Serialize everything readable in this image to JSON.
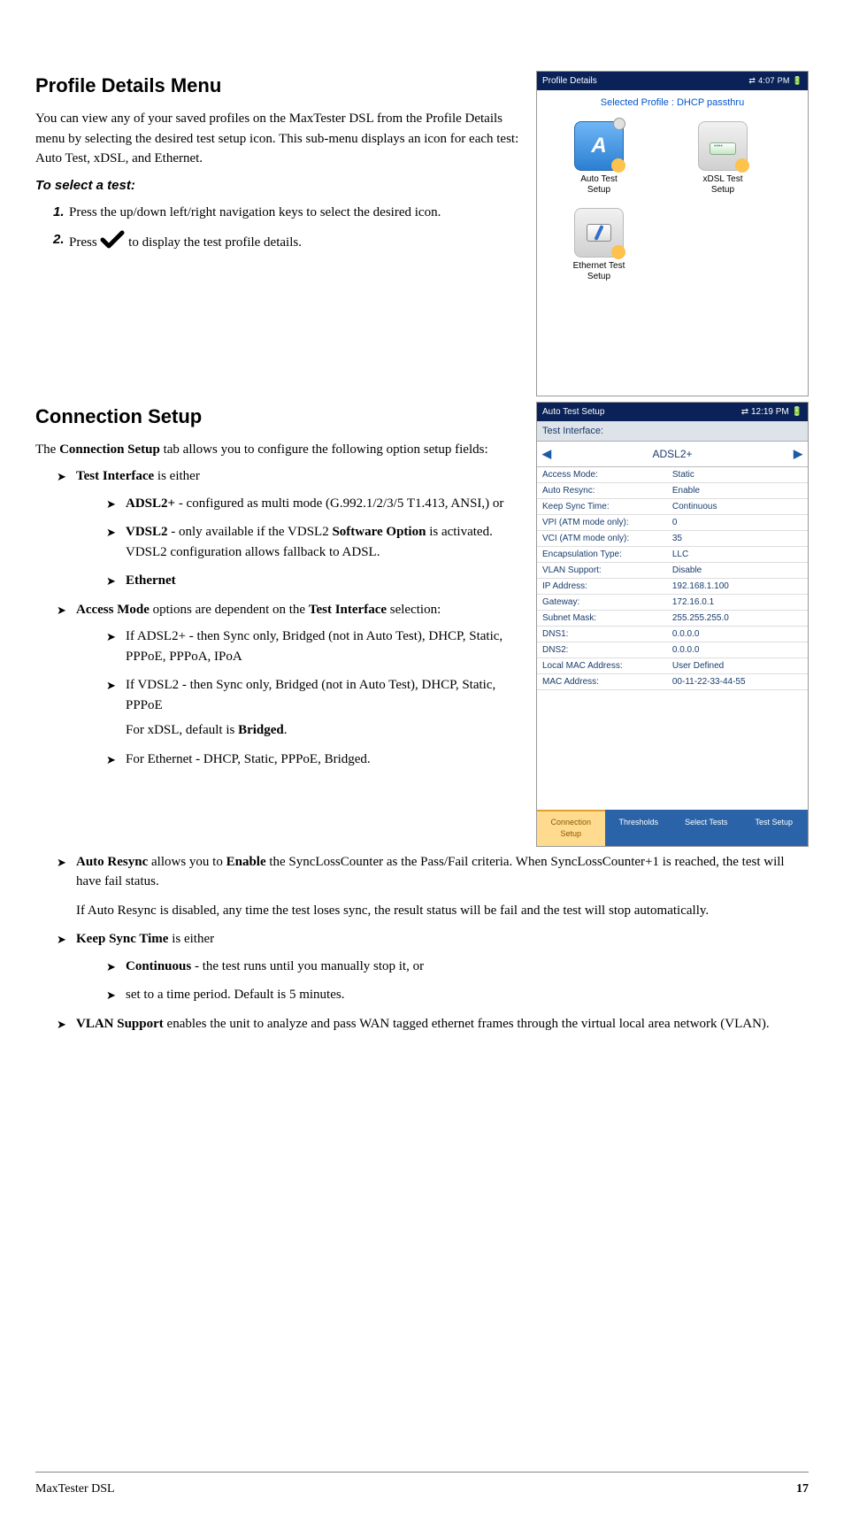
{
  "section1": {
    "heading": "Profile Details Menu",
    "intro": "You can view any of your saved profiles on the MaxTester DSL from the Profile Details menu by selecting the desired test setup icon. This sub-menu displays an icon for each test: Auto Test, xDSL, and Ethernet.",
    "subheading": "To select a test:",
    "steps": [
      {
        "num": "1.",
        "text": "Press the up/down left/right navigation keys to select the desired icon."
      },
      {
        "num": "2.",
        "pre": "Press ",
        "post": " to display the test profile details."
      }
    ]
  },
  "section2": {
    "heading": "Connection Setup",
    "intro_pre": "The ",
    "intro_bold": "Connection Setup",
    "intro_post": " tab allows you to configure the following option setup fields:",
    "test_interface": {
      "label_bold": "Test Interface",
      "label_rest": " is either",
      "items": {
        "adsl_bold": "ADSL2+",
        "adsl_rest": " - configured as multi mode (G.992.1/2/3/5 T1.413, ANSI,) or",
        "vdsl_bold": "VDSL2",
        "vdsl_mid": " - only available if the VDSL2 ",
        "vdsl_bold2": "Software Option",
        "vdsl_rest": " is activated. VDSL2 configuration allows fallback to ADSL.",
        "eth_bold": "Ethernet"
      }
    },
    "access_mode": {
      "bold1": "Access Mode",
      "mid": " options are dependent on the ",
      "bold2": "Test Interface",
      "rest": " selection:",
      "items": {
        "adsl": "If ADSL2+ - then Sync only, Bridged (not in Auto Test), DHCP, Static, PPPoE, PPPoA, IPoA",
        "vdsl": "If VDSL2 - then Sync only, Bridged (not in Auto Test), DHCP, Static, PPPoE",
        "default_pre": "For xDSL, default is ",
        "default_bold": "Bridged",
        "default_post": ".",
        "eth": "For Ethernet - DHCP, Static, PPPoE, Bridged."
      }
    },
    "auto_resync": {
      "bold1": "Auto Resync",
      "mid": " allows you to ",
      "bold2": "Enable",
      "rest": " the SyncLossCounter as the Pass/Fail criteria. When SyncLossCounter+1 is reached, the test will have fail status.",
      "para2": "If Auto Resync is disabled, any time the test loses sync, the result status will be fail and the test will stop automatically."
    },
    "keep_sync": {
      "bold": "Keep Sync Time",
      "rest": " is either",
      "items": {
        "cont_bold": "Continuous",
        "cont_rest": " - the test runs until you manually stop it, or",
        "period": "set to a time period. Default is 5 minutes."
      }
    },
    "vlan": {
      "bold": "VLAN Support",
      "rest": " enables the unit to analyze and pass WAN tagged ethernet frames through the virtual local area network (VLAN)."
    }
  },
  "sshot1": {
    "title": "Profile Details",
    "time": "4:07 PM",
    "selected": "Selected Profile : DHCP passthru",
    "tests": [
      {
        "label": "Auto Test\nSetup"
      },
      {
        "label": "xDSL Test\nSetup"
      },
      {
        "label": "Ethernet Test\nSetup"
      }
    ]
  },
  "sshot2": {
    "title": "Auto Test Setup",
    "time": "12:19 PM",
    "field_title": "Test Interface:",
    "selector_value": "ADSL2+",
    "rows": [
      [
        "Access Mode:",
        "Static"
      ],
      [
        "Auto Resync:",
        "Enable"
      ],
      [
        "Keep Sync Time:",
        "Continuous"
      ],
      [
        "VPI (ATM mode only):",
        "0"
      ],
      [
        "VCI (ATM mode only):",
        "35"
      ],
      [
        "Encapsulation Type:",
        "LLC"
      ],
      [
        "VLAN Support:",
        "Disable"
      ],
      [
        "IP Address:",
        "192.168.1.100"
      ],
      [
        "Gateway:",
        "172.16.0.1"
      ],
      [
        "Subnet Mask:",
        "255.255.255.0"
      ],
      [
        "DNS1:",
        "0.0.0.0"
      ],
      [
        "DNS2:",
        "0.0.0.0"
      ],
      [
        "Local MAC Address:",
        "User Defined"
      ],
      [
        "MAC Address:",
        "00-11-22-33-44-55"
      ]
    ],
    "tabs": [
      "Connection\nSetup",
      "Thresholds",
      "Select Tests",
      "Test Setup"
    ]
  },
  "footer": {
    "product": "MaxTester DSL",
    "page": "17"
  }
}
